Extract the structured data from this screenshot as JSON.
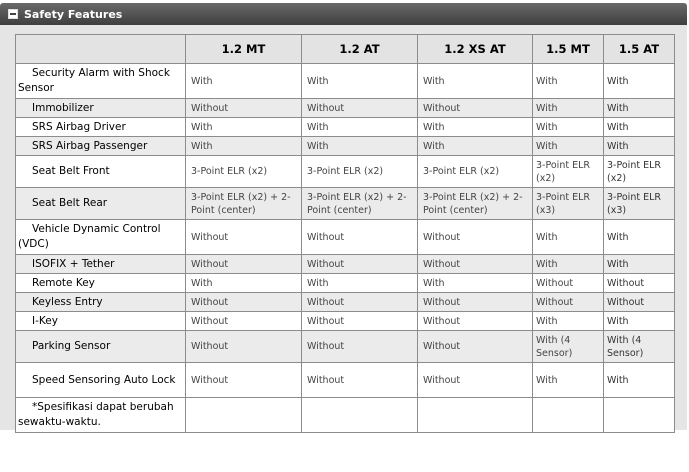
{
  "section": {
    "title": "Safety Features"
  },
  "columns": [
    "1.2 MT",
    "1.2 AT",
    "1.2 XS AT",
    "1.5 MT",
    "1.5 AT"
  ],
  "rows": [
    {
      "label": "Security Alarm with Shock Sensor",
      "values": [
        "With",
        "With",
        "With",
        "With",
        "With"
      ]
    },
    {
      "label": "Immobilizer",
      "values": [
        "Without",
        "Without",
        "Without",
        "With",
        "With"
      ]
    },
    {
      "label": "SRS Airbag Driver",
      "values": [
        "With",
        "With",
        "With",
        "With",
        "With"
      ]
    },
    {
      "label": "SRS Airbag Passenger",
      "values": [
        "With",
        "With",
        "With",
        "With",
        "With"
      ]
    },
    {
      "label": "Seat Belt Front",
      "values": [
        "3-Point ELR (x2)",
        "3-Point ELR (x2)",
        "3-Point ELR (x2)",
        "3-Point ELR (x2)",
        "3-Point ELR (x2)"
      ]
    },
    {
      "label": "Seat Belt Rear",
      "values": [
        "3-Point ELR (x2) + 2-Point (center)",
        "3-Point ELR (x2) + 2-Point (center)",
        "3-Point ELR (x2) + 2-Point (center)",
        "3-Point ELR (x3)",
        "3-Point ELR (x3)"
      ]
    },
    {
      "label": "Vehicle Dynamic Control (VDC)",
      "values": [
        "Without",
        "Without",
        "Without",
        "With",
        "With"
      ]
    },
    {
      "label": "ISOFIX + Tether",
      "values": [
        "Without",
        "Without",
        "Without",
        "With",
        "With"
      ]
    },
    {
      "label": "Remote Key",
      "values": [
        "With",
        "With",
        "With",
        "Without",
        "Without"
      ]
    },
    {
      "label": "Keyless Entry",
      "values": [
        "Without",
        "Without",
        "Without",
        "Without",
        "Without"
      ]
    },
    {
      "label": "I-Key",
      "values": [
        "Without",
        "Without",
        "Without",
        "With",
        "With"
      ]
    },
    {
      "label": "Parking Sensor",
      "values": [
        "Without",
        "Without",
        "Without",
        "With (4 Sensor)",
        "With (4 Sensor)"
      ]
    },
    {
      "label": "Speed Sensoring Auto Lock",
      "values": [
        "Without",
        "Without",
        "Without",
        "With",
        "With"
      ]
    }
  ],
  "footnote": "*Spesifikasi dapat berubah sewaktu-waktu."
}
